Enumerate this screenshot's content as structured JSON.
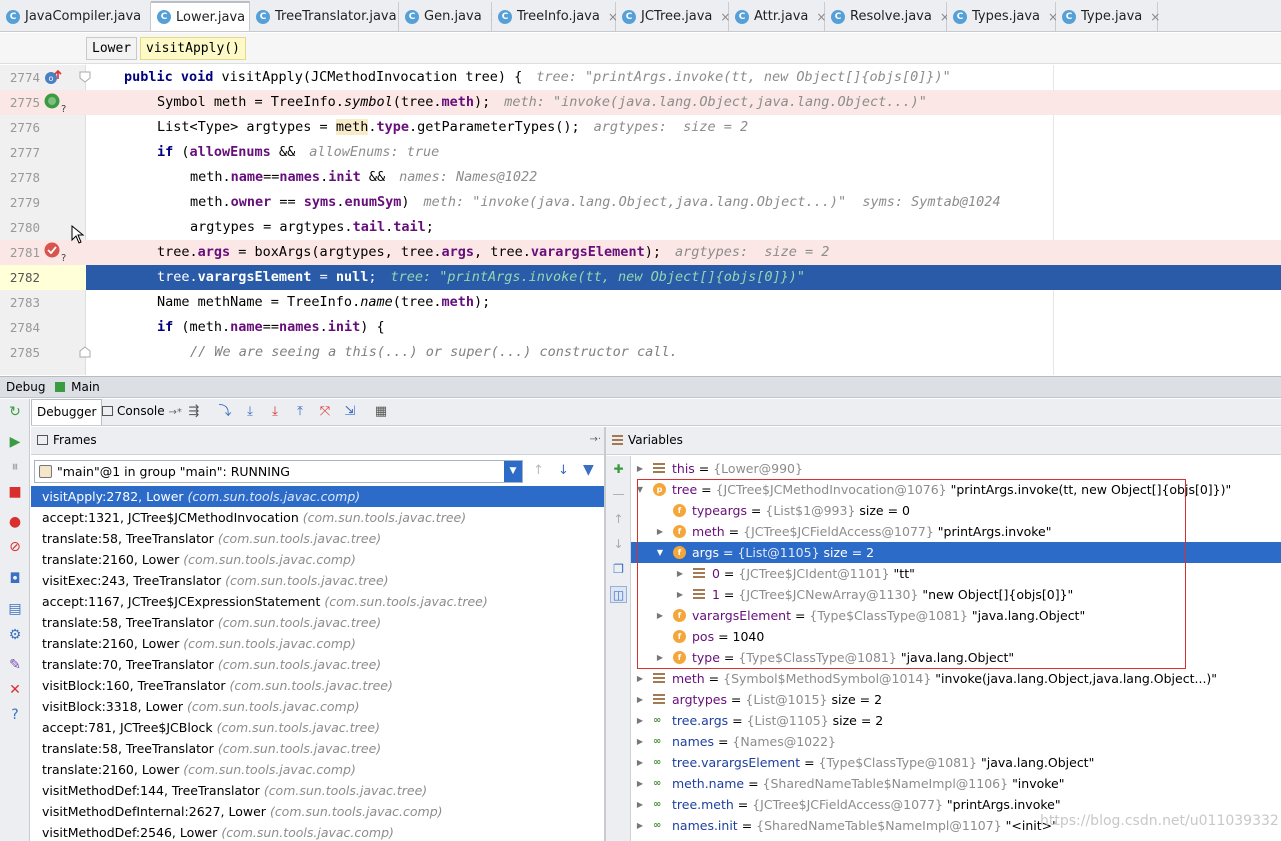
{
  "tabs": [
    {
      "label": "JavaCompiler.java",
      "active": false
    },
    {
      "label": "Lower.java",
      "active": true
    },
    {
      "label": "TreeTranslator.java",
      "active": false
    },
    {
      "label": "Gen.java",
      "active": false
    },
    {
      "label": "TreeInfo.java",
      "active": false
    },
    {
      "label": "JCTree.java",
      "active": false
    },
    {
      "label": "Attr.java",
      "active": false
    },
    {
      "label": "Resolve.java",
      "active": false
    },
    {
      "label": "Types.java",
      "active": false
    },
    {
      "label": "Type.java",
      "active": false
    }
  ],
  "tab_close_glyph": "×",
  "class_icon_letter": "C",
  "breadcrumbs": [
    "Lower",
    "visitApply()"
  ],
  "code_lines": [
    {
      "num": "2774",
      "indent": 0,
      "segs": [
        [
          "kw",
          "public "
        ],
        [
          "kw",
          "void "
        ],
        [
          "n",
          "visitApply(JCMethodInvocation tree) {"
        ]
      ],
      "hint": "tree: \"printArgs.invoke(tt, new Object[]{objs[0]})\""
    },
    {
      "num": "2775",
      "indent": 1,
      "segs": [
        [
          "n",
          "Symbol meth = TreeInfo."
        ],
        [
          "mi",
          "symbol"
        ],
        [
          "n",
          "(tree."
        ],
        [
          "fld",
          "meth"
        ],
        [
          "n",
          ");"
        ]
      ],
      "hint": "meth: \"invoke(java.lang.Object,java.lang.Object...)\""
    },
    {
      "num": "2776",
      "indent": 1,
      "segs": [
        [
          "n",
          "List<Type> argtypes = "
        ],
        [
          "hl",
          "meth"
        ],
        [
          "n",
          "."
        ],
        [
          "fld",
          "type"
        ],
        [
          "n",
          ".getParameterTypes();"
        ]
      ],
      "hint": "argtypes:  size = 2"
    },
    {
      "num": "2777",
      "indent": 1,
      "segs": [
        [
          "kw",
          "if "
        ],
        [
          "n",
          "("
        ],
        [
          "fld",
          "allowEnums"
        ],
        [
          "n",
          " &&"
        ]
      ],
      "hint": "allowEnums: true"
    },
    {
      "num": "2778",
      "indent": 2,
      "segs": [
        [
          "n",
          "meth."
        ],
        [
          "fld",
          "name"
        ],
        [
          "n",
          "=="
        ],
        [
          "fld",
          "names"
        ],
        [
          "n",
          "."
        ],
        [
          "fld",
          "init"
        ],
        [
          "n",
          " &&"
        ]
      ],
      "hint": "names: Names@1022"
    },
    {
      "num": "2779",
      "indent": 2,
      "segs": [
        [
          "n",
          "meth."
        ],
        [
          "fld",
          "owner"
        ],
        [
          "n",
          " == "
        ],
        [
          "fld",
          "syms"
        ],
        [
          "n",
          "."
        ],
        [
          "fld",
          "enumSym"
        ],
        [
          "n",
          ")"
        ]
      ],
      "hint": "meth: \"invoke(java.lang.Object,java.lang.Object...)\"  syms: Symtab@1024"
    },
    {
      "num": "2780",
      "indent": 2,
      "segs": [
        [
          "n",
          "argtypes = argtypes."
        ],
        [
          "fld",
          "tail"
        ],
        [
          "n",
          "."
        ],
        [
          "fld",
          "tail"
        ],
        [
          "n",
          ";"
        ]
      ],
      "hint": ""
    },
    {
      "num": "2781",
      "indent": 1,
      "segs": [
        [
          "n",
          "tree."
        ],
        [
          "fld",
          "args"
        ],
        [
          "n",
          " = boxArgs(argtypes, tree."
        ],
        [
          "fld",
          "args"
        ],
        [
          "n",
          ", tree."
        ],
        [
          "fld",
          "varargsElement"
        ],
        [
          "n",
          ");"
        ]
      ],
      "hint": "argtypes:  size = 2"
    },
    {
      "num": "2782",
      "indent": 1,
      "segs": [
        [
          "n",
          "tree."
        ],
        [
          "fld",
          "varargsElement"
        ],
        [
          "n",
          " = "
        ],
        [
          "kw",
          "null"
        ],
        [
          "n",
          ";"
        ]
      ],
      "hint": "tree: \"printArgs.invoke(tt, new Object[]{objs[0]})\""
    },
    {
      "num": "2783",
      "indent": 1,
      "segs": [
        [
          "n",
          "Name methName = TreeInfo."
        ],
        [
          "mi",
          "name"
        ],
        [
          "n",
          "(tree."
        ],
        [
          "fld",
          "meth"
        ],
        [
          "n",
          ");"
        ]
      ],
      "hint": ""
    },
    {
      "num": "2784",
      "indent": 1,
      "segs": [
        [
          "kw",
          "if "
        ],
        [
          "n",
          "(meth."
        ],
        [
          "fld",
          "name"
        ],
        [
          "n",
          "=="
        ],
        [
          "fld",
          "names"
        ],
        [
          "n",
          "."
        ],
        [
          "fld",
          "init"
        ],
        [
          "n",
          ") {"
        ]
      ],
      "hint": ""
    },
    {
      "num": "2785",
      "indent": 2,
      "segs": [
        [
          "cmt",
          "// We are seeing a this(...) or super(...) constructor call."
        ]
      ],
      "hint": ""
    }
  ],
  "debug_title": {
    "label": "Debug",
    "config": "Main"
  },
  "debug_tabs": {
    "debugger": "Debugger",
    "console": "Console"
  },
  "frames_title": "Frames",
  "variables_title": "Variables",
  "thread": "\"main\"@1 in group \"main\": RUNNING",
  "frames": [
    {
      "m": "visitApply:2782, Lower",
      "p": "(com.sun.tools.javac.comp)"
    },
    {
      "m": "accept:1321, JCTree$JCMethodInvocation",
      "p": "(com.sun.tools.javac.tree)"
    },
    {
      "m": "translate:58, TreeTranslator",
      "p": "(com.sun.tools.javac.tree)"
    },
    {
      "m": "translate:2160, Lower",
      "p": "(com.sun.tools.javac.comp)"
    },
    {
      "m": "visitExec:243, TreeTranslator",
      "p": "(com.sun.tools.javac.tree)"
    },
    {
      "m": "accept:1167, JCTree$JCExpressionStatement",
      "p": "(com.sun.tools.javac.tree)"
    },
    {
      "m": "translate:58, TreeTranslator",
      "p": "(com.sun.tools.javac.tree)"
    },
    {
      "m": "translate:2160, Lower",
      "p": "(com.sun.tools.javac.comp)"
    },
    {
      "m": "translate:70, TreeTranslator",
      "p": "(com.sun.tools.javac.tree)"
    },
    {
      "m": "visitBlock:160, TreeTranslator",
      "p": "(com.sun.tools.javac.tree)"
    },
    {
      "m": "visitBlock:3318, Lower",
      "p": "(com.sun.tools.javac.comp)"
    },
    {
      "m": "accept:781, JCTree$JCBlock",
      "p": "(com.sun.tools.javac.tree)"
    },
    {
      "m": "translate:58, TreeTranslator",
      "p": "(com.sun.tools.javac.tree)"
    },
    {
      "m": "translate:2160, Lower",
      "p": "(com.sun.tools.javac.comp)"
    },
    {
      "m": "visitMethodDef:144, TreeTranslator",
      "p": "(com.sun.tools.javac.tree)"
    },
    {
      "m": "visitMethodDefInternal:2627, Lower",
      "p": "(com.sun.tools.javac.comp)"
    },
    {
      "m": "visitMethodDef:2546, Lower",
      "p": "(com.sun.tools.javac.comp)"
    }
  ],
  "variables": [
    {
      "d": 0,
      "ar": "▶",
      "ic": "lst",
      "name": "this",
      "id": "{Lower@990}",
      "val": ""
    },
    {
      "d": 0,
      "ar": "▼",
      "ic": "par",
      "name": "tree",
      "id": "{JCTree$JCMethodInvocation@1076}",
      "val": "\"printArgs.invoke(tt, new Object[]{objs[0]})\""
    },
    {
      "d": 1,
      "ar": "",
      "ic": "fld",
      "name": "typeargs",
      "id": "{List$1@993}",
      "val": " size = 0"
    },
    {
      "d": 1,
      "ar": "▶",
      "ic": "fld",
      "name": "meth",
      "id": "{JCTree$JCFieldAccess@1077}",
      "val": "\"printArgs.invoke\""
    },
    {
      "d": 1,
      "ar": "▼",
      "ic": "fld",
      "name": "args",
      "id": "{List@1105}",
      "val": " size = 2",
      "sel": true
    },
    {
      "d": 2,
      "ar": "▶",
      "ic": "lst",
      "name": "0",
      "id": "{JCTree$JCIdent@1101}",
      "val": "\"tt\""
    },
    {
      "d": 2,
      "ar": "▶",
      "ic": "lst",
      "name": "1",
      "id": "{JCTree$JCNewArray@1130}",
      "val": "\"new Object[]{objs[0]}\""
    },
    {
      "d": 1,
      "ar": "▶",
      "ic": "fld",
      "name": "varargsElement",
      "id": "{Type$ClassType@1081}",
      "val": "\"java.lang.Object\""
    },
    {
      "d": 1,
      "ar": "",
      "ic": "fld",
      "name": "pos",
      "id": "",
      "val": "1040"
    },
    {
      "d": 1,
      "ar": "▶",
      "ic": "fld",
      "name": "type",
      "id": "{Type$ClassType@1081}",
      "val": "\"java.lang.Object\""
    },
    {
      "d": 0,
      "ar": "▶",
      "ic": "lst",
      "name": "meth",
      "id": "{Symbol$MethodSymbol@1014}",
      "val": "\"invoke(java.lang.Object,java.lang.Object...)\""
    },
    {
      "d": 0,
      "ar": "▶",
      "ic": "lst",
      "name": "argtypes",
      "id": "{List@1015}",
      "val": " size = 2"
    },
    {
      "d": 0,
      "ar": "▶",
      "ic": "wat",
      "name": "tree.args",
      "id": "{List@1105}",
      "val": " size = 2"
    },
    {
      "d": 0,
      "ar": "▶",
      "ic": "wat",
      "name": "names",
      "id": "{Names@1022}",
      "val": ""
    },
    {
      "d": 0,
      "ar": "▶",
      "ic": "wat",
      "name": "tree.varargsElement",
      "id": "{Type$ClassType@1081}",
      "val": "\"java.lang.Object\""
    },
    {
      "d": 0,
      "ar": "▶",
      "ic": "wat",
      "name": "meth.name",
      "id": "{SharedNameTable$NameImpl@1106}",
      "val": "\"invoke\""
    },
    {
      "d": 0,
      "ar": "▶",
      "ic": "wat",
      "name": "tree.meth",
      "id": "{JCTree$JCFieldAccess@1077}",
      "val": "\"printArgs.invoke\""
    },
    {
      "d": 0,
      "ar": "▶",
      "ic": "wat",
      "name": "names.init",
      "id": "{SharedNameTable$NameImpl@1107}",
      "val": "\"<init>\""
    }
  ],
  "field_icon_letter": "f",
  "param_icon_letter": "p",
  "watermark": "https://blog.csdn.net/u011039332",
  "colors": {
    "accent": "#2d6bc8",
    "current_line": "#2a5ba8",
    "breakpoint_line": "#fbe7e5",
    "highlight_box": "#d9302f"
  }
}
